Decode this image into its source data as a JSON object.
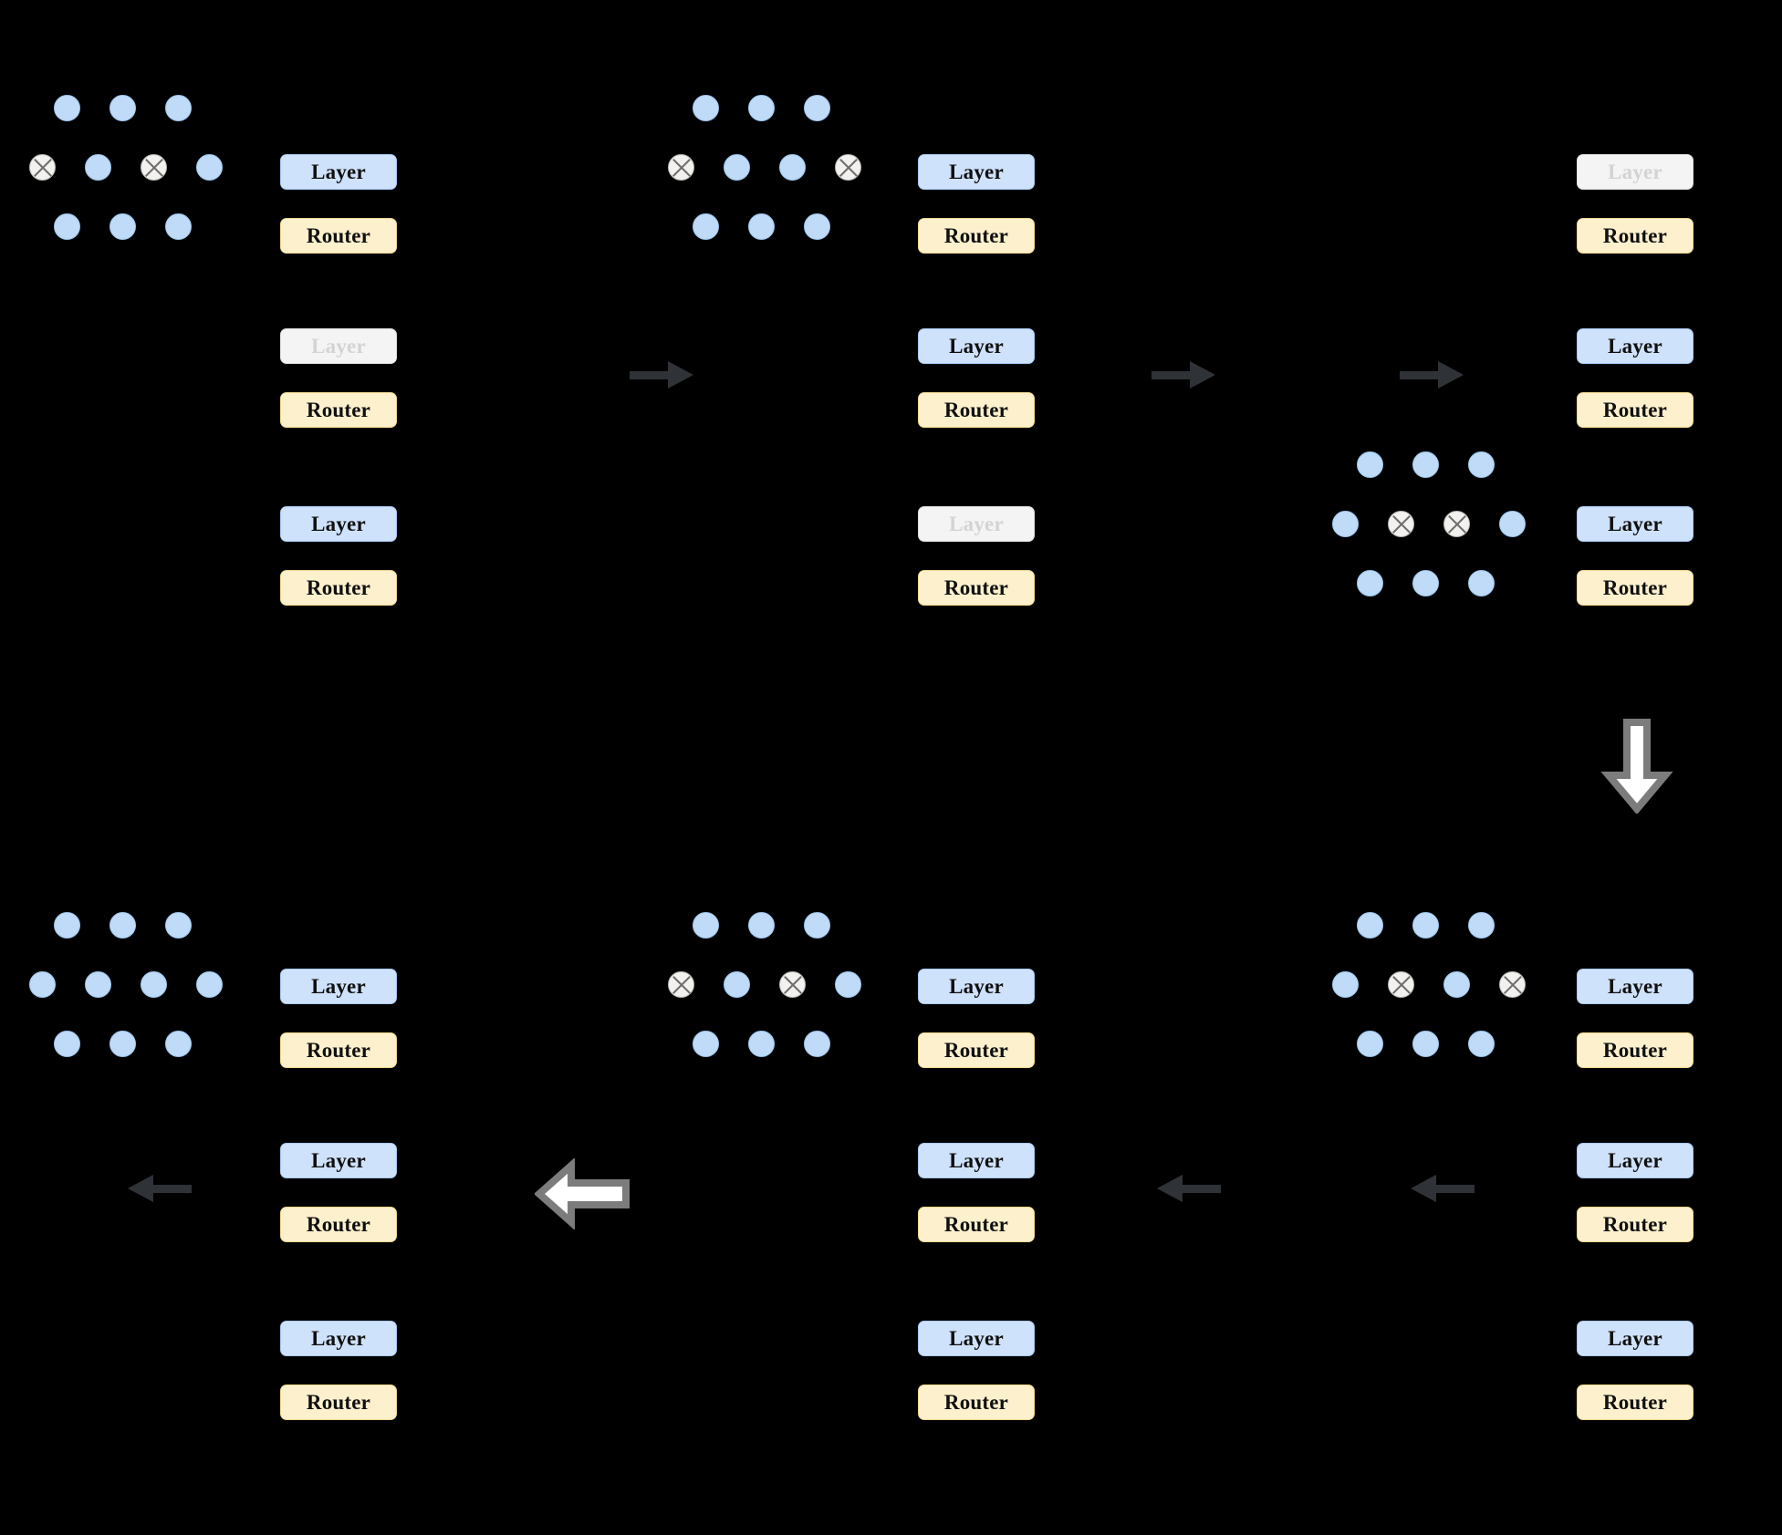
{
  "diagram": {
    "background_color": "#000000",
    "labels": {
      "layer": "Layer",
      "router": "Router"
    },
    "colors": {
      "expert_active": "#bfdbf7",
      "expert_pruned": "#f2f1ef",
      "layer_active_bg": "#cfe2fb",
      "layer_active_border": "#a9c9f2",
      "layer_inactive_bg": "#f4f4f4",
      "layer_inactive_text": "#d3d3d3",
      "router_bg": "#fdf0cd",
      "router_border": "#f3d98d",
      "arrow_small": "#2f3237",
      "arrow_big_fill": "#ffffff",
      "arrow_big_stroke": "#7c7c7c"
    },
    "icons": {
      "expert_active": "filled-circle-icon",
      "expert_pruned": "crossed-circle-icon",
      "arrow_right": "arrow-right-icon",
      "arrow_left": "arrow-left-icon",
      "arrow_down": "arrow-down-icon"
    },
    "stages": [
      {
        "id": "stage-1",
        "position": "top-left",
        "experts": {
          "attached_to_slot": 0,
          "rows": [
            [
              "active",
              "active",
              "active"
            ],
            [
              "pruned",
              "active",
              "pruned",
              "active"
            ],
            [
              "active",
              "active",
              "active"
            ]
          ]
        },
        "blocks": [
          {
            "layer": "Layer",
            "layer_state": "active",
            "router": "Router"
          },
          {
            "layer": "Layer",
            "layer_state": "inactive",
            "router": "Router"
          },
          {
            "layer": "Layer",
            "layer_state": "active",
            "router": "Router"
          }
        ]
      },
      {
        "id": "stage-2",
        "position": "top-middle",
        "experts": {
          "attached_to_slot": 0,
          "rows": [
            [
              "active",
              "active",
              "active"
            ],
            [
              "pruned",
              "active",
              "active",
              "pruned"
            ],
            [
              "active",
              "active",
              "active"
            ]
          ]
        },
        "blocks": [
          {
            "layer": "Layer",
            "layer_state": "active",
            "router": "Router"
          },
          {
            "layer": "Layer",
            "layer_state": "active",
            "router": "Router"
          },
          {
            "layer": "Layer",
            "layer_state": "inactive",
            "router": "Router"
          }
        ]
      },
      {
        "id": "stage-3",
        "position": "top-right",
        "experts": {
          "attached_to_slot": 2,
          "rows": [
            [
              "active",
              "active",
              "active"
            ],
            [
              "active",
              "pruned",
              "pruned",
              "active"
            ],
            [
              "active",
              "active",
              "active"
            ]
          ]
        },
        "blocks": [
          {
            "layer": "Layer",
            "layer_state": "inactive",
            "router": "Router"
          },
          {
            "layer": "Layer",
            "layer_state": "active",
            "router": "Router"
          },
          {
            "layer": "Layer",
            "layer_state": "active",
            "router": "Router"
          }
        ]
      },
      {
        "id": "stage-4",
        "position": "bottom-right",
        "experts": {
          "attached_to_slot": 0,
          "rows": [
            [
              "active",
              "active",
              "active"
            ],
            [
              "active",
              "pruned",
              "active",
              "pruned"
            ],
            [
              "active",
              "active",
              "active"
            ]
          ]
        },
        "blocks": [
          {
            "layer": "Layer",
            "layer_state": "active",
            "router": "Router"
          },
          {
            "layer": "Layer",
            "layer_state": "active",
            "router": "Router"
          },
          {
            "layer": "Layer",
            "layer_state": "active",
            "router": "Router"
          }
        ]
      },
      {
        "id": "stage-5",
        "position": "bottom-middle",
        "experts": {
          "attached_to_slot": 0,
          "rows": [
            [
              "active",
              "active",
              "active"
            ],
            [
              "pruned",
              "active",
              "pruned",
              "active"
            ],
            [
              "active",
              "active",
              "active"
            ]
          ]
        },
        "blocks": [
          {
            "layer": "Layer",
            "layer_state": "active",
            "router": "Router"
          },
          {
            "layer": "Layer",
            "layer_state": "active",
            "router": "Router"
          },
          {
            "layer": "Layer",
            "layer_state": "active",
            "router": "Router"
          }
        ]
      },
      {
        "id": "stage-6",
        "position": "bottom-left",
        "experts": {
          "attached_to_slot": 0,
          "rows": [
            [
              "active",
              "active",
              "active"
            ],
            [
              "active",
              "active",
              "active",
              "active"
            ],
            [
              "active",
              "active",
              "active"
            ]
          ]
        },
        "blocks": [
          {
            "layer": "Layer",
            "layer_state": "active",
            "router": "Router"
          },
          {
            "layer": "Layer",
            "layer_state": "active",
            "router": "Router"
          },
          {
            "layer": "Layer",
            "layer_state": "active",
            "router": "Router"
          }
        ]
      }
    ],
    "arrows": [
      {
        "id": "arrow-1",
        "kind": "small",
        "direction": "right",
        "from": "stage-1",
        "to": "stage-2"
      },
      {
        "id": "arrow-2",
        "kind": "small",
        "direction": "right",
        "from": "stage-2",
        "to": "stage-3"
      },
      {
        "id": "arrow-3",
        "kind": "small",
        "direction": "right",
        "from": "stage-3",
        "to": "stage-3"
      },
      {
        "id": "arrow-4",
        "kind": "big",
        "direction": "down",
        "from": "stage-3",
        "to": "stage-4"
      },
      {
        "id": "arrow-5",
        "kind": "small",
        "direction": "left",
        "from": "stage-4",
        "to": "stage-4"
      },
      {
        "id": "arrow-6",
        "kind": "small",
        "direction": "left",
        "from": "stage-4",
        "to": "stage-5"
      },
      {
        "id": "arrow-7",
        "kind": "big",
        "direction": "left",
        "from": "stage-5",
        "to": "stage-6"
      },
      {
        "id": "arrow-8",
        "kind": "small",
        "direction": "left",
        "from": "stage-6",
        "to": "exit"
      }
    ]
  }
}
